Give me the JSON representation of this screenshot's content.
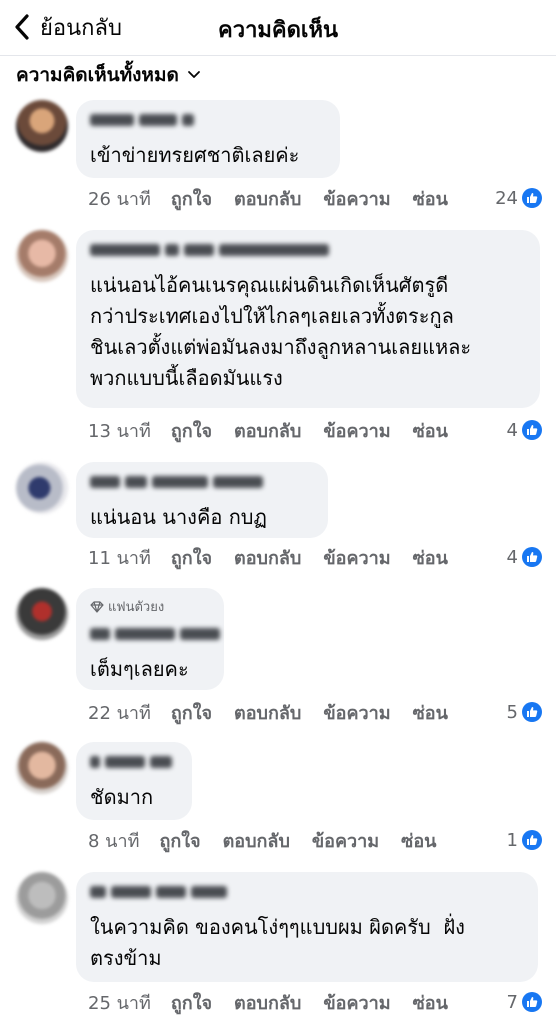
{
  "header": {
    "back_label": "ย้อนกลับ",
    "title": "ความคิดเห็น"
  },
  "filter": {
    "label": "ความคิดเห็นทั้งหมด",
    "icon": "chevron-down-icon"
  },
  "actions": {
    "like": "ถูกใจ",
    "reply": "ตอบกลับ",
    "message": "ข้อความ",
    "hide": "ซ่อน"
  },
  "comments": [
    {
      "text": "เข้าข่ายทรยศชาติเลยค่ะ",
      "time": "26 นาที",
      "reactions": "24"
    },
    {
      "text": "แน่นอนไอ้คนเนรคุณแผ่นดินเกิดเห็นศัตรูดี\nกว่าประเทศเองไปให้ไกลๆเลยเลวทั้งตระกูล\nชินเลวตั้งแต่พ่อมันลงมาถึงลูกหลานเลยแหละ\nพวกแบบนี้เลือดมันแรง",
      "time": "13 นาที",
      "reactions": "4"
    },
    {
      "text": "แน่นอน นางคือ กบฏ",
      "time": "11 นาที",
      "reactions": "4"
    },
    {
      "badge": "แฟนตัวยง",
      "text": "เต็มๆเลยคะ",
      "time": "22 นาที",
      "reactions": "5"
    },
    {
      "text": "ชัดมาก",
      "time": "8 นาที",
      "reactions": "1"
    },
    {
      "text": "ในความคิด ของคนโง่ๆๆแบบผม ผิดครับ  ฝั่ง\nตรงข้าม",
      "time": "25 นาที",
      "reactions": "7"
    }
  ],
  "colors": {
    "accent": "#1877f2",
    "bubble": "#f0f2f5",
    "secondary_text": "#65676b"
  }
}
